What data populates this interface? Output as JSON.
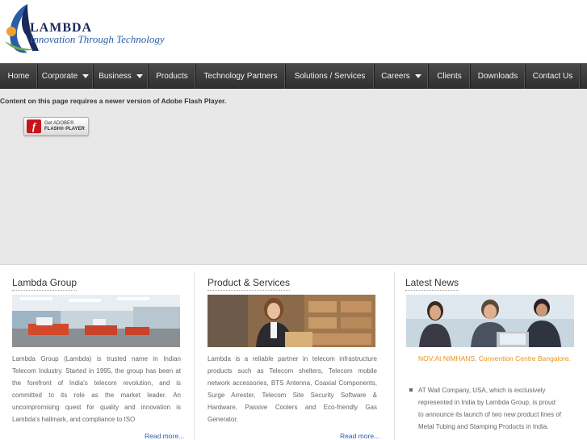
{
  "logo": {
    "word": "LAMBDA",
    "tagline": "Innovation Through Technology"
  },
  "nav": {
    "items": [
      {
        "label": "Home",
        "dropdown": false
      },
      {
        "label": "Corporate",
        "dropdown": true
      },
      {
        "label": "Business",
        "dropdown": true
      },
      {
        "label": "Products",
        "dropdown": false
      },
      {
        "label": "Technology Partners",
        "dropdown": false
      },
      {
        "label": "Solutions / Services",
        "dropdown": false
      },
      {
        "label": "Careers",
        "dropdown": true
      },
      {
        "label": "Clients",
        "dropdown": false
      },
      {
        "label": "Downloads",
        "dropdown": false
      },
      {
        "label": "Contact Us",
        "dropdown": false
      }
    ]
  },
  "flash": {
    "message": "Content on this page requires a newer version of Adobe Flash Player.",
    "button_line1": "Get ADOBE®",
    "button_line2": "FLASH® PLAYER"
  },
  "columns": {
    "group": {
      "title": "Lambda Group",
      "text": "Lambda Group (Lambda) is trusted name in Indian Telecom Industry. Started in 1995, the group has been at the forefront of India's telecom revolution, and is committed to its role as the market leader. An uncompromising quest for quality and innovation is Lambda's hallmark, and compliance to ISO",
      "read_more": "Read more..."
    },
    "products": {
      "title": "Product & Services",
      "text": "Lambda is a reliable partner in telecom infrastructure products such as Telecom shelters, Telecom mobile network accessories, BTS Antenna, Coaxial Components, Surge Arrester, Telecom Site Security Software & Hardware, Passive Coolers and Eco-friendly Gas Generator.",
      "read_more": "Read more..."
    },
    "news": {
      "title": "Latest News",
      "highlight": "NOV:At NIMHANS, Convention Centre Bangalore.",
      "item": "AT Wall Company, USA, which is exclusively represented in India by Lambda Group, is proud to announce its launch of two new product lines of Metal Tubing and Stamping Products in India."
    }
  },
  "colors": {
    "nav_bg": "#3a3a3a",
    "link": "#2a5da8",
    "news_highlight": "#e8921e",
    "logo_blue": "#2a5da8",
    "logo_orange": "#f0a030"
  }
}
